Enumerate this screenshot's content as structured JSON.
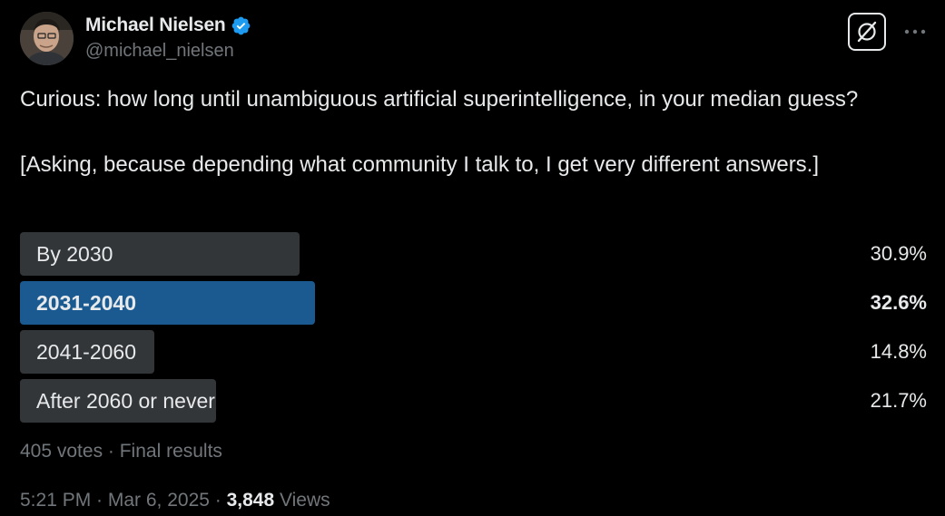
{
  "author": {
    "display_name": "Michael Nielsen",
    "handle": "@michael_nielsen",
    "verified": true,
    "verified_color": "#1d9bf0"
  },
  "header_actions": {
    "grok_icon": "grok-icon",
    "more_icon": "more-icon"
  },
  "tweet": {
    "line1": "Curious: how long until unambiguous artificial superintelligence, in your median guess?",
    "line2": "[Asking, because depending what community I talk to, I get very different answers.]"
  },
  "poll": {
    "options": [
      {
        "label": "By 2030",
        "percent_text": "30.9%",
        "percent": 30.9,
        "winner": false
      },
      {
        "label": "2031-2040",
        "percent_text": "32.6%",
        "percent": 32.6,
        "winner": true
      },
      {
        "label": "2041-2060",
        "percent_text": "14.8%",
        "percent": 14.8,
        "winner": false
      },
      {
        "label": "After 2060 or never",
        "percent_text": "21.7%",
        "percent": 21.7,
        "winner": false
      }
    ],
    "bar_color": "#333639",
    "winner_color": "#1a5a91",
    "meta": "405 votes · Final results"
  },
  "footer": {
    "timestamp": "5:21 PM · Mar 6, 2025 · ",
    "views_count": "3,848",
    "views_label": " Views"
  }
}
